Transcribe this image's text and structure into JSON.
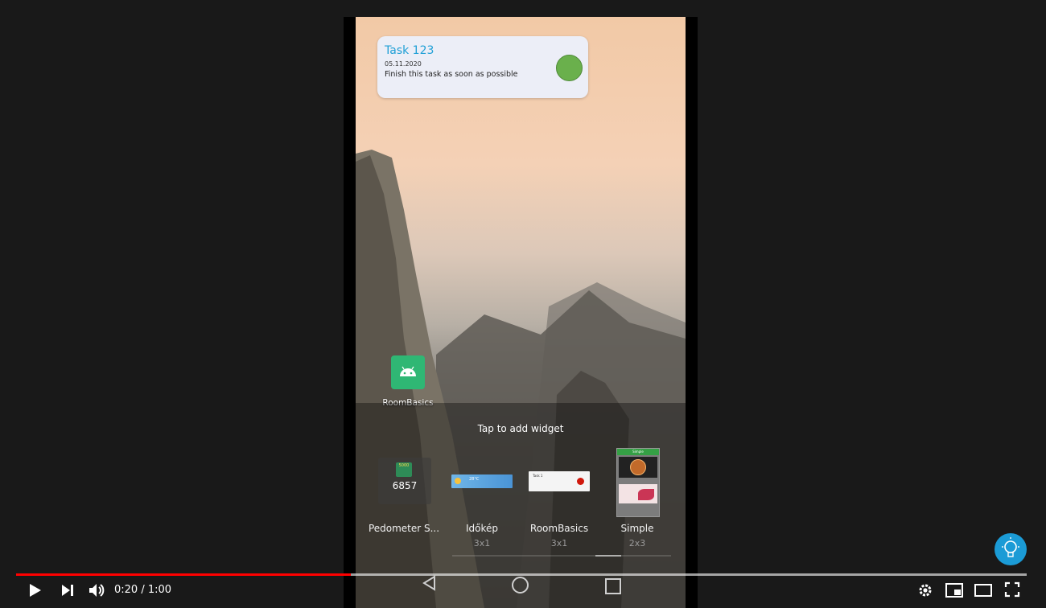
{
  "task_widget": {
    "title": "Task 123",
    "date": "05.11.2020",
    "description": "Finish this task as soon as possible",
    "status_color": "#6ab04c"
  },
  "home_app": {
    "label": "RoomBasics",
    "icon": "android-icon"
  },
  "tap_hint": "Tap to add widget",
  "widgets": [
    {
      "name": "Pedometer S...",
      "size": "",
      "preview": {
        "badge": "5000",
        "count": "6857"
      }
    },
    {
      "name": "Időkép",
      "size": "3x1",
      "preview": {
        "temp": "28°C"
      }
    },
    {
      "name": "RoomBasics",
      "size": "3x1",
      "preview": {
        "title": "Task 1"
      }
    },
    {
      "name": "Simple",
      "size": "2x3",
      "preview": {
        "header": "Simple"
      }
    }
  ],
  "player": {
    "time_current": "0:20",
    "time_total": "1:00",
    "time_display": "0:20 / 1:00",
    "progress_fraction": 0.333,
    "accent_color": "#ff0000",
    "icons": [
      "play-icon",
      "next-icon",
      "volume-icon",
      "settings-icon",
      "miniplayer-icon",
      "theater-icon",
      "fullscreen-icon",
      "lightbulb-icon"
    ]
  }
}
